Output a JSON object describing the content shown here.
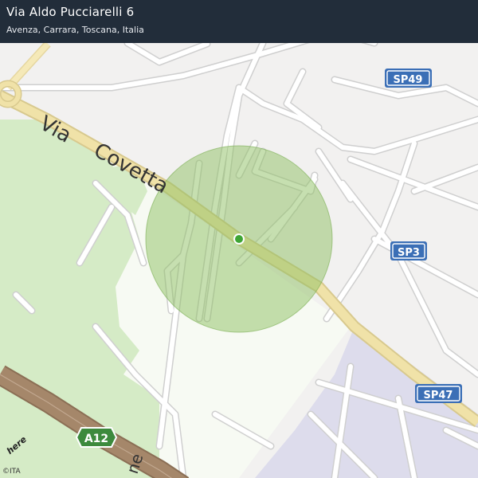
{
  "header": {
    "title": "Via Aldo Pucciarelli 6",
    "subtitle": "Avenza, Carrara, Toscana, Italia"
  },
  "map": {
    "street_labels": {
      "via_coveta_1": "Via",
      "via_coveta_2": "Covetta",
      "bottom_partial": "ne"
    },
    "route_shields": {
      "sp49": "SP49",
      "sp3": "SP3",
      "sp47": "SP47",
      "a12": "A12"
    },
    "colors": {
      "accuracy_circle": "#8dbf62",
      "location_dot": "#3fa535",
      "motorway": "#a5876a",
      "main_road": "#f0e2a8",
      "park": "#d5ebc6",
      "industrial": "#dddcec",
      "shield_blue": "#3b6fb6",
      "shield_green": "#3d8a3d"
    }
  },
  "footer": {
    "logo": "here",
    "copyright": "©ITA"
  }
}
